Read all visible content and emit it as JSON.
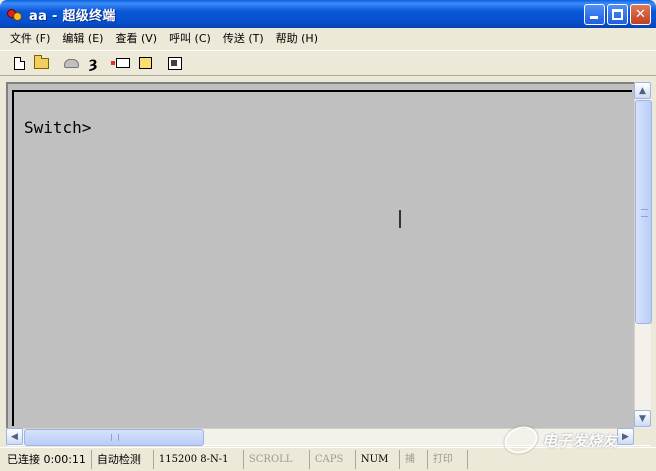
{
  "window": {
    "title": "aa - 超级终端",
    "minimize_label": "_",
    "close_label": "✕"
  },
  "menu": {
    "items": [
      {
        "label": "文件 (F)"
      },
      {
        "label": "编辑 (E)"
      },
      {
        "label": "查看 (V)"
      },
      {
        "label": "呼叫 (C)"
      },
      {
        "label": "传送 (T)"
      },
      {
        "label": "帮助 (H)"
      }
    ]
  },
  "toolbar": {
    "icons": [
      "new-icon",
      "open-icon",
      "call-icon",
      "disconnect-icon",
      "send-icon",
      "receive-icon",
      "properties-icon"
    ]
  },
  "terminal": {
    "line": "Switch>"
  },
  "scrollbar": {
    "up_arrow": "▲",
    "down_arrow": "▼",
    "left_arrow": "◀",
    "right_arrow": "▶"
  },
  "status": {
    "connection": "已连接 0:00:11",
    "detect": "自动检测",
    "settings": "115200 8-N-1",
    "scroll": "SCROLL",
    "caps": "CAPS",
    "num": "NUM",
    "capture": "捕",
    "print": "打印"
  },
  "watermark": {
    "text": "电子发烧友"
  },
  "colors": {
    "titlebar": "#0a58d8",
    "terminal_bg": "#c0c0c0",
    "chrome": "#ece9d8"
  }
}
